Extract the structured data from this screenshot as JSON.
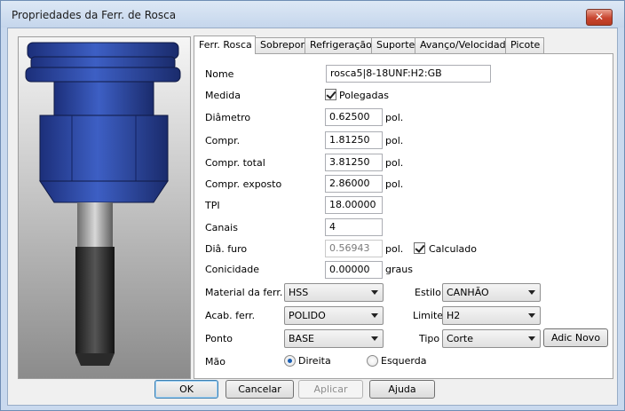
{
  "window": {
    "title": "Propriedades da Ferr. de Rosca",
    "close_glyph": "✕"
  },
  "tabs": [
    {
      "label": "Ferr. Rosca",
      "active": true
    },
    {
      "label": "Sobrepor"
    },
    {
      "label": "Refrigeração"
    },
    {
      "label": "Suporte"
    },
    {
      "label": "Avanço/Velocidade"
    },
    {
      "label": "Picote"
    }
  ],
  "form": {
    "nome": {
      "label": "Nome",
      "value": "rosca5|8-18UNF:H2:GB"
    },
    "medida": {
      "label": "Medida",
      "checkbox_label": "Polegadas",
      "checked": true
    },
    "diametro": {
      "label": "Diâmetro",
      "value": "0.62500",
      "unit": "pol."
    },
    "compr": {
      "label": "Compr.",
      "value": "1.81250",
      "unit": "pol."
    },
    "compr_total": {
      "label": "Compr. total",
      "value": "3.81250",
      "unit": "pol."
    },
    "compr_exposto": {
      "label": "Compr. exposto",
      "value": "2.86000",
      "unit": "pol."
    },
    "tpi": {
      "label": "TPI",
      "value": "18.00000"
    },
    "canais": {
      "label": "Canais",
      "value": "4"
    },
    "dia_furo": {
      "label": "Diâ. furo",
      "value": "0.56943",
      "unit": "pol.",
      "checkbox_label": "Calculado",
      "checked": true
    },
    "conicidade": {
      "label": "Conicidade",
      "value": "0.00000",
      "unit": "graus"
    },
    "material": {
      "label": "Material da ferr.",
      "value": "HSS"
    },
    "estilo": {
      "label": "Estilo",
      "value": "CANHÃO"
    },
    "acab": {
      "label": "Acab. ferr.",
      "value": "POLIDO"
    },
    "limite": {
      "label": "Limite",
      "value": "H2"
    },
    "ponto": {
      "label": "Ponto",
      "value": "BASE"
    },
    "tipo": {
      "label": "Tipo",
      "value": "Corte"
    },
    "adic_novo": "Adic Novo",
    "mao": {
      "label": "Mão",
      "options": [
        "Direita",
        "Esquerda"
      ],
      "selected": "Direita"
    }
  },
  "buttons": {
    "ok": "OK",
    "cancel": "Cancelar",
    "apply": "Aplicar",
    "help": "Ajuda"
  },
  "colors": {
    "tool_blue": "#2f4fa8",
    "accent": "#3c7fb1"
  }
}
